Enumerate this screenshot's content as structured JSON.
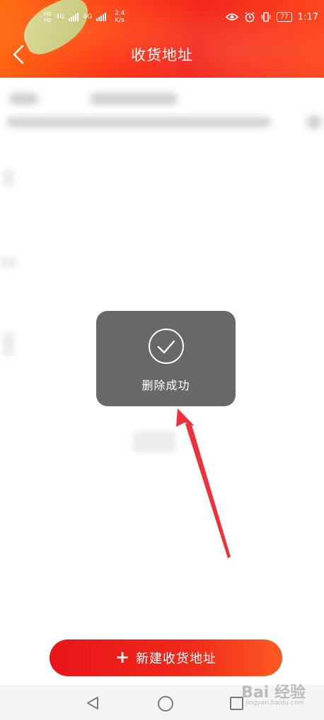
{
  "status_bar": {
    "sim1_label": "HD",
    "sim2_label": "HD",
    "network_type_1": "4G",
    "network_type_2": "4G",
    "speed_value": "2.4",
    "speed_unit": "K/s",
    "battery": "77",
    "time": "1:17"
  },
  "header": {
    "title": "收货地址"
  },
  "toast": {
    "message": "删除成功"
  },
  "footer": {
    "add_button_label": "新建收货地址"
  },
  "watermark": {
    "text": "Bai 经验",
    "sub": "jingyan.baidu.com"
  },
  "colors": {
    "brand_red": "#f3261c",
    "annotation_red": "#f0303a",
    "toast_bg": "#686868"
  },
  "icons": {
    "back": "chevron-left-icon",
    "toast": "check-circle-icon",
    "add": "plus-icon"
  }
}
